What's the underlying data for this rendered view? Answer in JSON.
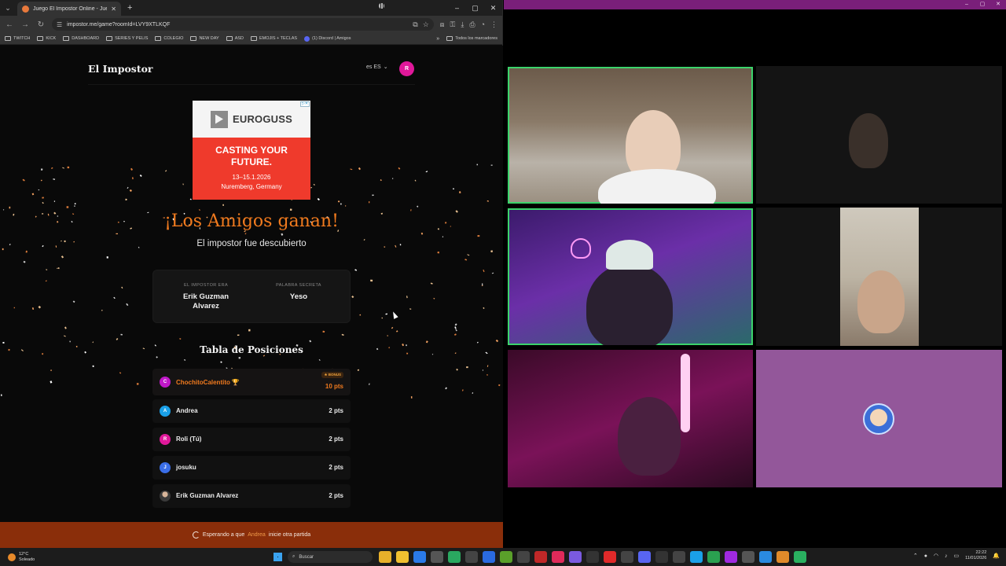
{
  "browser": {
    "tab_title": "Juego El Impostor Online - Jueg",
    "url": "impostor.me/game?roomId=LVY9XTLKQF",
    "bookmarks": [
      "TWITCH",
      "KICK",
      "DASHBOARD",
      "SERIES Y PELIS",
      "COLEGIO",
      "NEW DAY",
      "ASD",
      "EMOJIS + TECLAS",
      "(1) Discord | Amigos"
    ],
    "all_bookmarks": "Todos los marcadores"
  },
  "site": {
    "logo": "El Impostor",
    "language": "es ES",
    "user_initial": "R"
  },
  "ad": {
    "brand": "EUROGUSS",
    "headline_1": "CASTING YOUR",
    "headline_2": "FUTURE.",
    "dates": "13–15.1.2026",
    "location": "Nuremberg, Germany"
  },
  "result": {
    "title": "¡Los Amigos ganan!",
    "subtitle": "El impostor fue descubierto",
    "impostor_label": "EL IMPOSTOR ERA",
    "impostor_name": "Erik Guzman Alvarez",
    "word_label": "PALABRA SECRETA",
    "word": "Yeso"
  },
  "leaderboard": {
    "title": "Tabla de Posiciones",
    "bonus_label": "★ BONUS",
    "players": [
      {
        "initial": "C",
        "name": "ChochitoCalentito",
        "points": "10 pts",
        "color": "#c018c8"
      },
      {
        "initial": "A",
        "name": "Andrea",
        "points": "2 pts",
        "color": "#1aa0e8"
      },
      {
        "initial": "R",
        "name": "Roli (Tú)",
        "points": "2 pts",
        "color": "#e0189a"
      },
      {
        "initial": "J",
        "name": "josuku",
        "points": "2 pts",
        "color": "#3a6ee8"
      },
      {
        "initial": "",
        "name": "Erik Guzman Alvarez",
        "points": "2 pts",
        "color": "#555555"
      }
    ]
  },
  "waiting": {
    "prefix": "Esperando a que",
    "host": "Andrea",
    "suffix": "inicie otra partida"
  },
  "taskbar": {
    "temperature": "12°C",
    "weather": "Soleado",
    "search_placeholder": "Buscar",
    "time": "22:22",
    "date": "11/01/2026"
  }
}
